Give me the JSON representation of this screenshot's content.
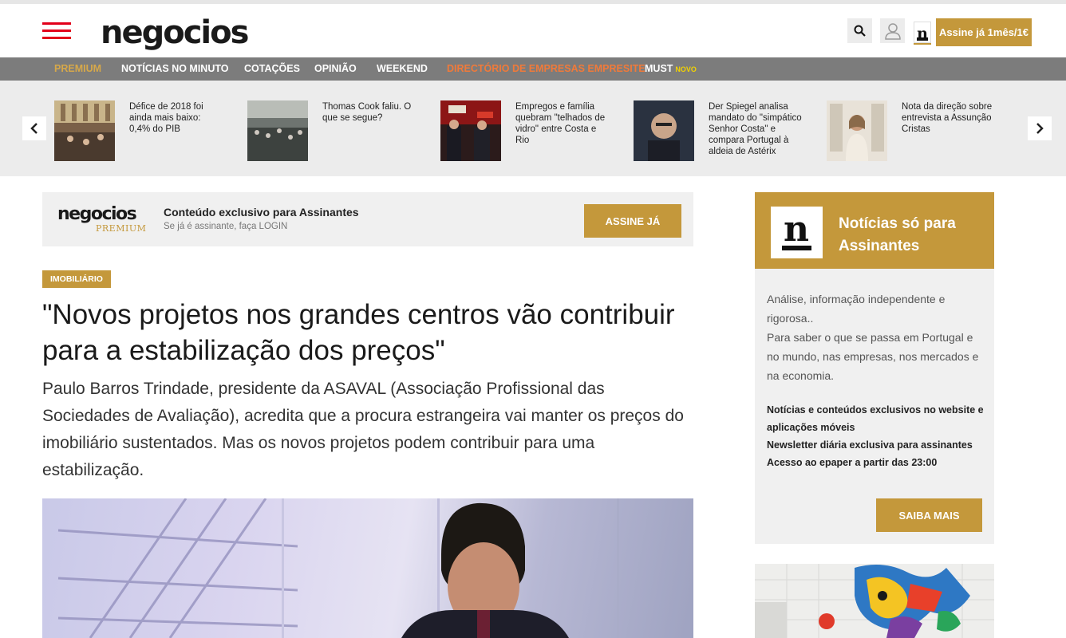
{
  "header": {
    "logo_text": "negocios",
    "subscribe_label": "Assine já 1mês/1€",
    "brand_color": "#e2001a",
    "gold_color": "#c4983b"
  },
  "nav": {
    "items": [
      {
        "label": "PREMIUM"
      },
      {
        "label": "NOTÍCIAS NO MINUTO"
      },
      {
        "label": "COTAÇÕES"
      },
      {
        "label": "OPINIÃO"
      },
      {
        "label": "WEEKEND"
      },
      {
        "label": "DIRECTÓRIO DE EMPRESAS EMPRESITE"
      },
      {
        "label": "MUST",
        "badge": "NOVO"
      }
    ]
  },
  "strip": {
    "stories": [
      {
        "title": "Défice de 2018 foi ainda mais baixo: 0,4% do PIB"
      },
      {
        "title": "Thomas Cook faliu. O que se segue?"
      },
      {
        "title": "Empregos e família quebram \"telhados de vidro\" entre Costa e Rio"
      },
      {
        "title": "Der Spiegel analisa mandato do \"simpático Senhor Costa\" e compara Portugal à aldeia de Astérix"
      },
      {
        "title": "Nota da direção sobre entrevista a Assunção Cristas"
      }
    ]
  },
  "premium_banner": {
    "logo_word": "negocios",
    "logo_sub": "PREMIUM",
    "title": "Conteúdo exclusivo para Assinantes",
    "subtitle": "Se já é assinante, faça LOGIN",
    "button_label": "ASSINE JÁ"
  },
  "article": {
    "tag": "IMOBILIÁRIO",
    "headline": "\"Novos projetos nos grandes centros vão contribuir para a estabilização dos preços\"",
    "lead": "Paulo Barros Trindade, presidente da ASAVAL (Associação Profissional das Sociedades de Avaliação), acredita que a procura estrangeira vai manter os preços do imobiliário sustentados. Mas os novos projetos podem contribuir para uma estabilização."
  },
  "sidebar": {
    "logo_letter": "n",
    "title": "Notícias só para Assinantes",
    "description_1": "Análise, informação independente e rigorosa..",
    "description_2": "Para saber o que se passa em Portugal e no mundo, nas empresas, nos mercados e na economia.",
    "features": [
      "Notícias e conteúdos exclusivos no website e aplicações móveis",
      "Newsletter diária exclusiva para assinantes",
      "Acesso ao epaper a partir das 23:00"
    ],
    "button_label": "SAIBA MAIS"
  }
}
